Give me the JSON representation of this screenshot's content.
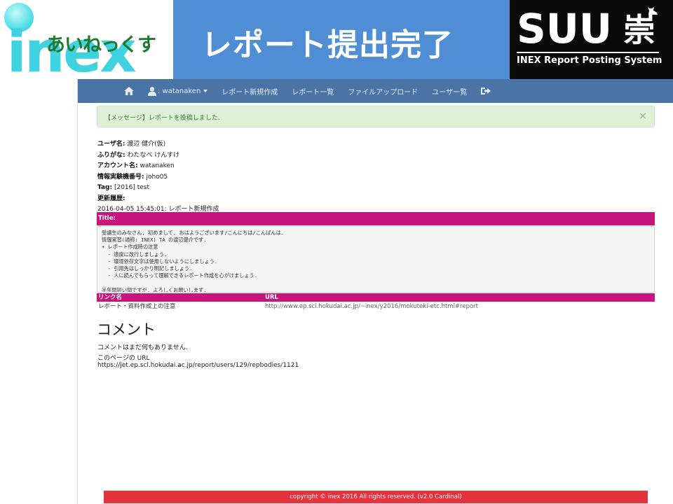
{
  "banner": {
    "logo_word": "inex",
    "logo_kana": "あいねっくす",
    "title": "レポート提出完了",
    "suu_word": "SUU",
    "suu_kanji": "崇",
    "suu_subtitle": "INEX Report Posting System"
  },
  "navbar": {
    "home_icon": "home-icon",
    "user_label": ": watanaken",
    "user_icon": "user-icon",
    "items": [
      {
        "label": "レポート新規作成"
      },
      {
        "label": "レポート一覧"
      },
      {
        "label": "ファイルアップロード"
      },
      {
        "label": "ユーザ一覧"
      }
    ],
    "logout_icon": "sign-out-icon"
  },
  "alert": {
    "text": "【メッセージ】レポートを投稿しました.",
    "close": "×"
  },
  "info": {
    "username_label": "ユーザ名:",
    "username": "渡辺 健介(仮)",
    "furigana_label": "ふりがな:",
    "furigana": "わたなべ けんすけ",
    "account_label": "アカウント名:",
    "account": "watanaken",
    "machine_label": "情報実験機番号:",
    "machine": "joho05",
    "tag_label": "Tag:",
    "tag": "[2016] test",
    "history_label": "更新履歴:",
    "history": "2016-04-05 15:45:01: レポート新規作成"
  },
  "report": {
    "title_label": "Title:",
    "body": "受講生のみなさん, 初めまして, おはようございます/こんにちは/こんばんは.\n情報実習(通称: INEX) TA の渡辺健介です.\n+ レポート作成時の注意\n  - 適度に改行しましょう.\n  - 環境依存文字は使用しないようにしましょう.\n  - 引用先はしっかり明記しましょう.\n  - 人に読んでもらって理解できるレポート作成を心がけましょう.\n\n半年間短い間ですが, よろしくお願いします."
  },
  "links": {
    "headers": [
      "リンク名",
      "URL"
    ],
    "rows": [
      {
        "name": "レポート・資料作成上の注意",
        "url": "http://www.ep.sci.hokudai.ac.jp/~inex/y2016/mokuteki-etc.html#report"
      }
    ]
  },
  "comments": {
    "heading": "コメント",
    "empty": "コメントはまだ何もありません.",
    "page_url_label": "このページの URL",
    "page_url": "https://jet.ep.sci.hokudai.ac.jp/report/users/129/repbodies/1121"
  },
  "footer": {
    "text": "copyright © inex 2016 All rights reserved. (v2.0 Cardinal)"
  },
  "colors": {
    "navbar": "#4a73a6",
    "banner_blue": "#4f8ed4",
    "accent_magenta": "#c8157e",
    "alert_bg": "#dff0d8",
    "footer": "#e5323b"
  }
}
